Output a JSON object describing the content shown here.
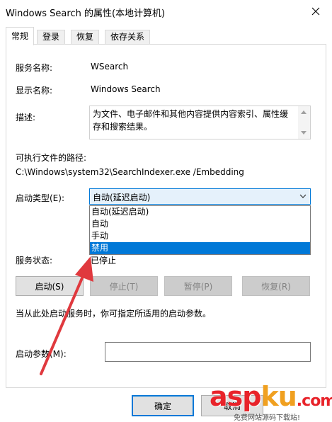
{
  "window": {
    "title": "Windows Search 的属性(本地计算机)"
  },
  "tabs": [
    {
      "label": "常规"
    },
    {
      "label": "登录"
    },
    {
      "label": "恢复"
    },
    {
      "label": "依存关系"
    }
  ],
  "general": {
    "service_name_label": "服务名称:",
    "service_name_value": "WSearch",
    "display_name_label": "显示名称:",
    "display_name_value": "Windows Search",
    "description_label": "描述:",
    "description_value": "为文件、电子邮件和其他内容提供内容索引、属性缓存和搜索结果。",
    "exe_path_label": "可执行文件的路径:",
    "exe_path_value": "C:\\Windows\\system32\\SearchIndexer.exe /Embedding",
    "startup_type_label": "启动类型(E):",
    "startup_type_value": "自动(延迟启动)",
    "startup_options": [
      "自动(延迟启动)",
      "自动",
      "手动",
      "禁用"
    ],
    "selected_option_index": 3,
    "service_status_label": "服务状态:",
    "service_status_value": "已停止",
    "buttons": {
      "start": "启动(S)",
      "stop": "停止(T)",
      "pause": "暂停(P)",
      "resume": "恢复(R)"
    },
    "hint_text": "当从此处启动服务时，你可指定所适用的启动参数。",
    "start_params_label": "启动参数(M):",
    "start_params_value": ""
  },
  "footer": {
    "ok": "确定",
    "cancel": "取消"
  },
  "watermark": {
    "brand_a": "asp",
    "brand_b": "ku",
    "brand_c": ".com",
    "tagline": "免费网站源码下载站!"
  },
  "colors": {
    "accent": "#0078d7",
    "annotation_arrow": "#e0393e",
    "watermark_red": "#e8232a"
  },
  "icons": {
    "close": "close-icon",
    "dropdown": "chevron-down-icon"
  }
}
